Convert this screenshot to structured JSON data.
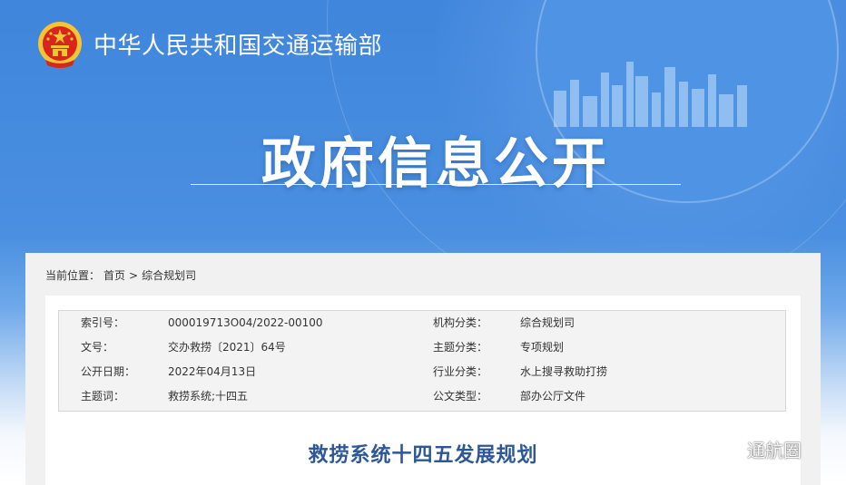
{
  "header": {
    "ministry_name": "中华人民共和国交通运输部",
    "portal_title": "政府信息公开"
  },
  "breadcrumb": {
    "prefix": "当前位置：",
    "items": [
      "首页",
      "综合规划司"
    ],
    "separator": ">"
  },
  "metadata": {
    "rows": [
      {
        "label_left": "索引号：",
        "value_left": "000019713O04/2022-00100",
        "label_right": "机构分类：",
        "value_right": "综合规划司"
      },
      {
        "label_left": "文号：",
        "value_left": "交办救捞〔2021〕64号",
        "label_right": "主题分类：",
        "value_right": "专项规划"
      },
      {
        "label_left": "公开日期：",
        "value_left": "2022年04月13日",
        "label_right": "行业分类：",
        "value_right": "水上搜寻救助打捞"
      },
      {
        "label_left": "主题词：",
        "value_left": "救捞系统;十四五",
        "label_right": "公文类型：",
        "value_right": "部办公厅文件"
      }
    ]
  },
  "document": {
    "title": "救捞系统十四五发展规划"
  },
  "watermark": {
    "text": "通航圈",
    "icon": "wechat-icon"
  },
  "colors": {
    "banner_blue": "#4a8fe0",
    "doc_title_blue": "#2d5797",
    "panel_gray": "#f1f1f1",
    "emblem_red": "#d7261e",
    "emblem_gold": "#f4c433"
  }
}
